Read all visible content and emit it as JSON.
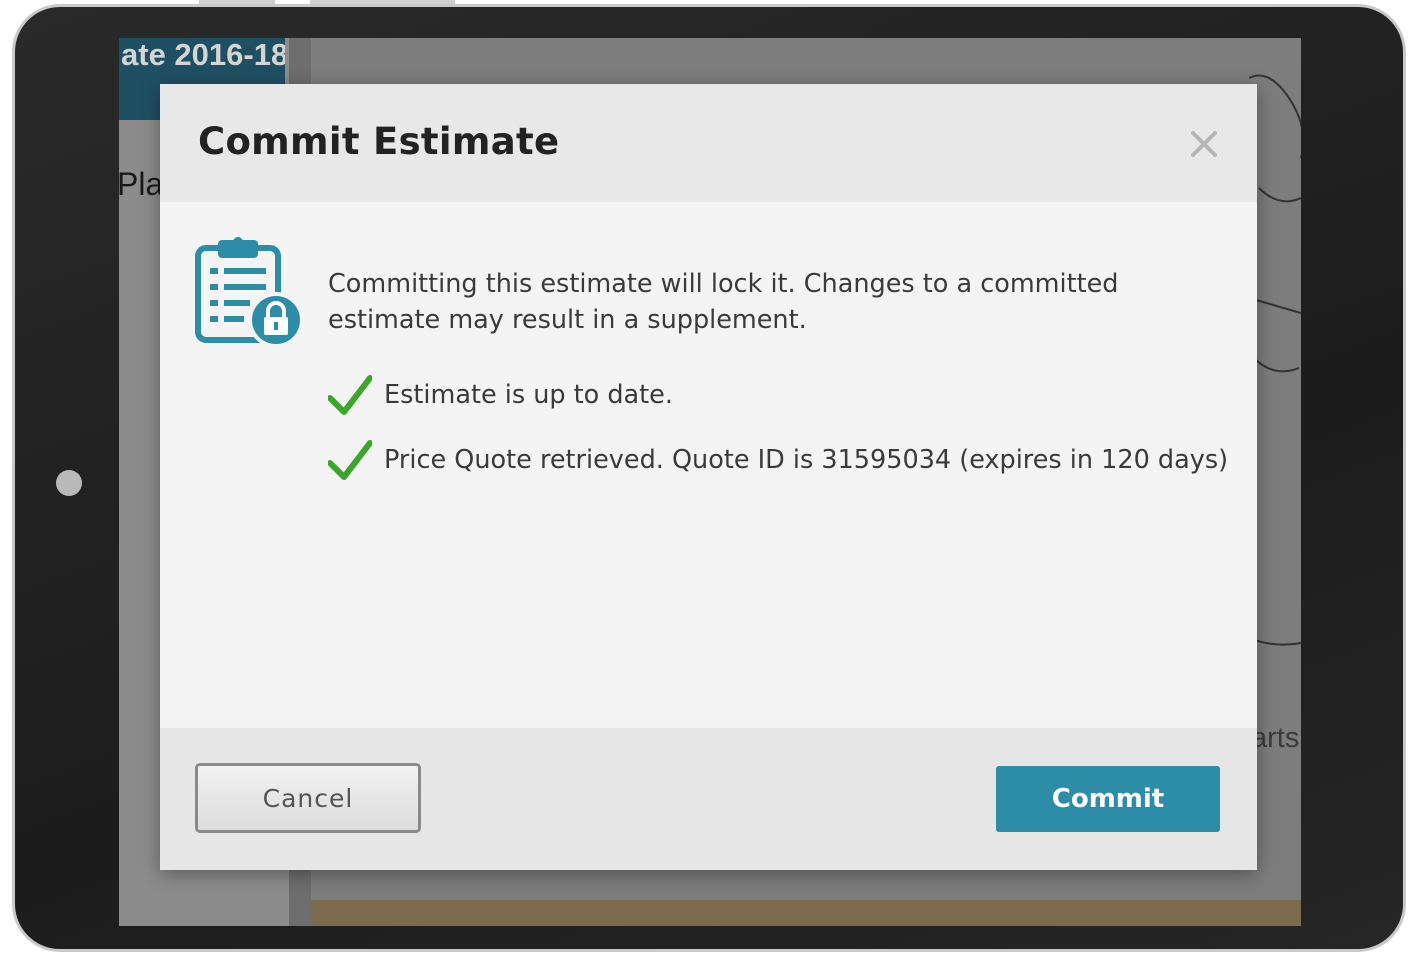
{
  "background": {
    "title": "ate 2016-18",
    "subtitle": "Plat",
    "right_text": "arts"
  },
  "modal": {
    "title": "Commit Estimate",
    "close_icon": "close-icon",
    "icon": "clipboard-lock-icon",
    "message": "Committing this estimate will lock it. Changes to a committed estimate may result in a supplement.",
    "checks": [
      {
        "icon": "checkmark-icon",
        "text": "Estimate is up to date."
      },
      {
        "icon": "checkmark-icon",
        "text": "Price Quote retrieved. Quote ID is 31595034 (expires in 120 days)"
      }
    ],
    "cancel_label": "Cancel",
    "commit_label": "Commit"
  },
  "colors": {
    "accent": "#2e8da6",
    "check": "#3aa72a",
    "icon": "#2e8da6"
  }
}
